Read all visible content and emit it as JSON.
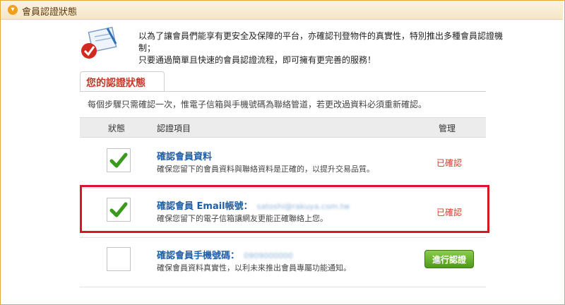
{
  "header": {
    "title": "會員認證狀態"
  },
  "intro": {
    "line1": "以為了讓會員們能享有更安全及保障的平台，亦確認刊登物件的真實性，特別推出多種會員認證機制；",
    "line2": "只要通過簡單且快速的會員認證流程，即可擁有更完善的服務！"
  },
  "tab": {
    "label": "您的認證狀態"
  },
  "notice": "每個步驟只需確認一次，惟電子信箱與手機號碼為聯絡管道，若更改過資料必須重新確認。",
  "table": {
    "headers": {
      "status": "狀態",
      "item": "認證項目",
      "manage": "管理"
    },
    "rows": [
      {
        "title": "確認會員資料",
        "detail": "",
        "desc": "確保您留下的會員資料與聯絡資料是正確的，以提升交易品質。",
        "status": "已確認",
        "checked": true
      },
      {
        "title": "確認會員 Email帳號：",
        "detail": "satoshi@rakuya.com.tw",
        "desc": "確保您留下的電子信箱讓網友更能正確聯絡上您。",
        "status": "已確認",
        "checked": true
      },
      {
        "title": "確認會員手機號碼：",
        "detail": "0909000000",
        "desc": "確保會員資料真實性，以利未來推出會員專屬功能通知。",
        "status": "",
        "checked": false,
        "button": "進行認證"
      }
    ]
  },
  "colors": {
    "accent_orange": "#f2a01c",
    "title_red": "#c0392b",
    "link_blue": "#1f5fa8",
    "confirmed_red": "#d43b2a",
    "check_green": "#3a9a1c",
    "highlight_red": "#d9142a"
  },
  "icons": {
    "title": "chevron-down-icon",
    "intro": "certificate-check-icon",
    "check": "checkmark-icon"
  }
}
